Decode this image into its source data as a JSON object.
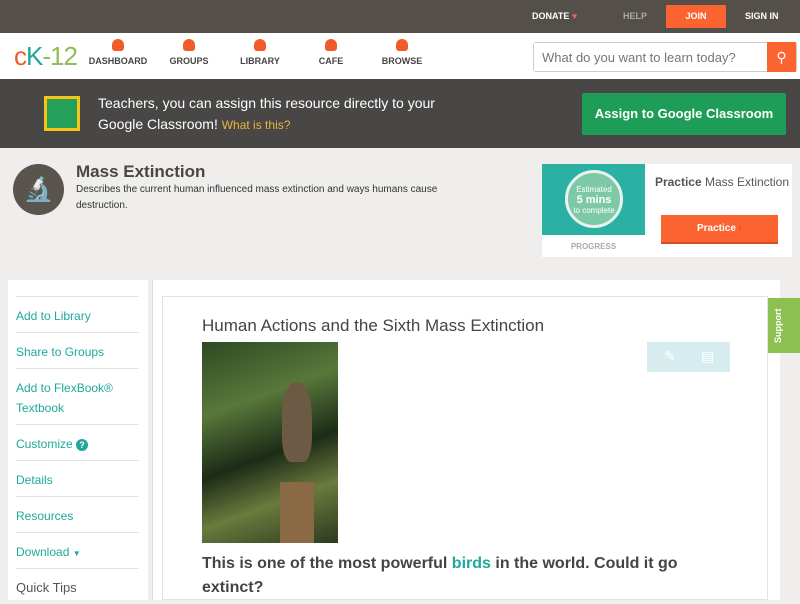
{
  "topbar": {
    "donate": "DONATE",
    "help": "HELP",
    "join": "JOIN",
    "signin": "SIGN IN"
  },
  "nav": {
    "logo": "cK-12",
    "items": [
      "DASHBOARD",
      "GROUPS",
      "LIBRARY",
      "CAFE",
      "BROWSE"
    ],
    "search_placeholder": "What do you want to learn today?"
  },
  "banner": {
    "text": "Teachers, you can assign this resource directly to your Google Classroom!",
    "link": "What is this?",
    "button": "Assign to Google Classroom"
  },
  "header": {
    "title": "Mass Extinction",
    "description": "Describes the current human influenced mass extinction and ways humans cause destruction."
  },
  "practice": {
    "estimated": "Estimated",
    "mins": "5 mins",
    "to_complete": "to complete",
    "progress": "PROGRESS",
    "title_bold": "Practice",
    "title_rest": " Mass Extinction",
    "button": "Practice"
  },
  "sidebar": {
    "items": [
      "Add to Library",
      "Share to Groups",
      "Add to FlexBook® Textbook",
      "Customize",
      "Details",
      "Resources",
      "Download"
    ],
    "quick_tips": "Quick Tips"
  },
  "content": {
    "title": "Human Actions and the Sixth Mass Extinction",
    "lead_before": "This is one of the most powerful ",
    "lead_link": "birds",
    "lead_after": " in the world. Could it go extinct?"
  },
  "support": "Support",
  "colors": {
    "accent": "#fb6431",
    "teal": "#1fa89b",
    "green": "#1e9d59"
  }
}
